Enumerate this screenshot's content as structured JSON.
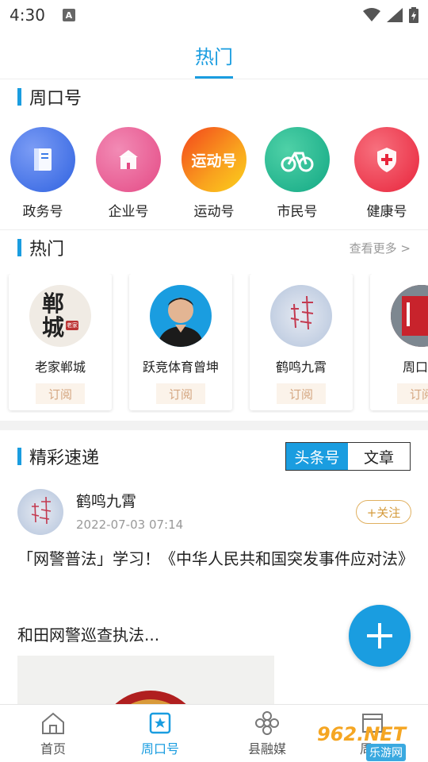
{
  "status": {
    "time": "4:30",
    "notif_letter": "A"
  },
  "top_tabs": [
    {
      "label": "热门",
      "active": true
    }
  ],
  "sections": {
    "zhoukou": {
      "title": "周口号"
    },
    "hot": {
      "title": "热门",
      "more": "查看更多 >"
    },
    "feed": {
      "title": "精彩速递"
    }
  },
  "categories": [
    {
      "label": "政务号",
      "icon": "book-icon",
      "color": "#3b7be8"
    },
    {
      "label": "企业号",
      "icon": "building-icon",
      "color": "#ea4c8c"
    },
    {
      "label": "运动号",
      "icon": "sport-logo-icon",
      "color": "#f7961e",
      "badge_text": "运动号"
    },
    {
      "label": "市民号",
      "icon": "bicycle-icon",
      "color": "#16b58c"
    },
    {
      "label": "健康号",
      "icon": "health-shield-icon",
      "color": "#ee3348"
    }
  ],
  "hot_cards": [
    {
      "name": "老家郸城",
      "subscribe": "订阅",
      "avatar_glyph_1": "郸",
      "avatar_glyph_2": "城",
      "avatar_stamp": "老家"
    },
    {
      "name": "跃竞体育曾坤",
      "subscribe": "订阅"
    },
    {
      "name": "鹤鸣九霄",
      "subscribe": "订阅"
    },
    {
      "name": "周口同",
      "subscribe": "订阅"
    }
  ],
  "feed": {
    "segments": [
      {
        "label": "头条号",
        "active": true
      },
      {
        "label": "文章",
        "active": false
      }
    ],
    "post": {
      "author": "鹤鸣九霄",
      "time": "2022-07-03 07:14",
      "follow": "+关注",
      "title": "「网警普法」学习！《中华人民共和国突发事件应对法》",
      "summary": "和田网警巡查执法..."
    }
  },
  "bottom_nav": [
    {
      "label": "首页",
      "icon": "home-icon",
      "active": false
    },
    {
      "label": "周口号",
      "icon": "star-badge-icon",
      "active": true
    },
    {
      "label": "县融媒",
      "icon": "flower-icon",
      "active": false
    },
    {
      "label": "周口",
      "icon": "film-icon",
      "active": false
    }
  ],
  "watermark": {
    "text_1": "962.NET",
    "text_2": "乐游网"
  },
  "colors": {
    "accent": "#1a9de0",
    "follow": "#d49a3a",
    "subscribe_bg": "#fbf3ea"
  }
}
